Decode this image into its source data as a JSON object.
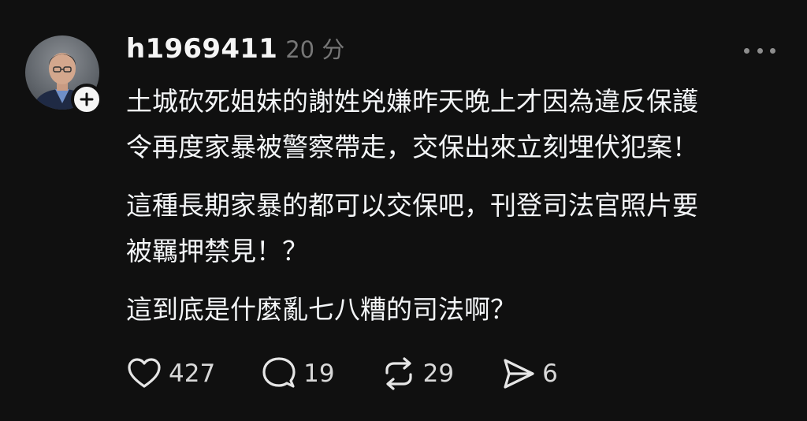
{
  "post": {
    "username": "h1969411",
    "time": "20 分",
    "paragraphs": [
      "土城砍死姐妹的謝姓兇嫌昨天晚上才因為違反保護\n令再度家暴被警察帶走，交保出來立刻埋伏犯案！",
      "這種長期家暴的都可以交保吧，刊登司法官照片要\n被羈押禁見！？",
      "這到底是什麼亂七八糟的司法啊？"
    ]
  },
  "actions": {
    "like": {
      "icon": "heart-icon",
      "count": "427"
    },
    "comment": {
      "icon": "comment-icon",
      "count": "19"
    },
    "repost": {
      "icon": "repost-icon",
      "count": "29"
    },
    "share": {
      "icon": "send-icon",
      "count": "6"
    }
  },
  "colors": {
    "background": "#101010",
    "text": "#f3f5f7",
    "muted": "#777777"
  }
}
